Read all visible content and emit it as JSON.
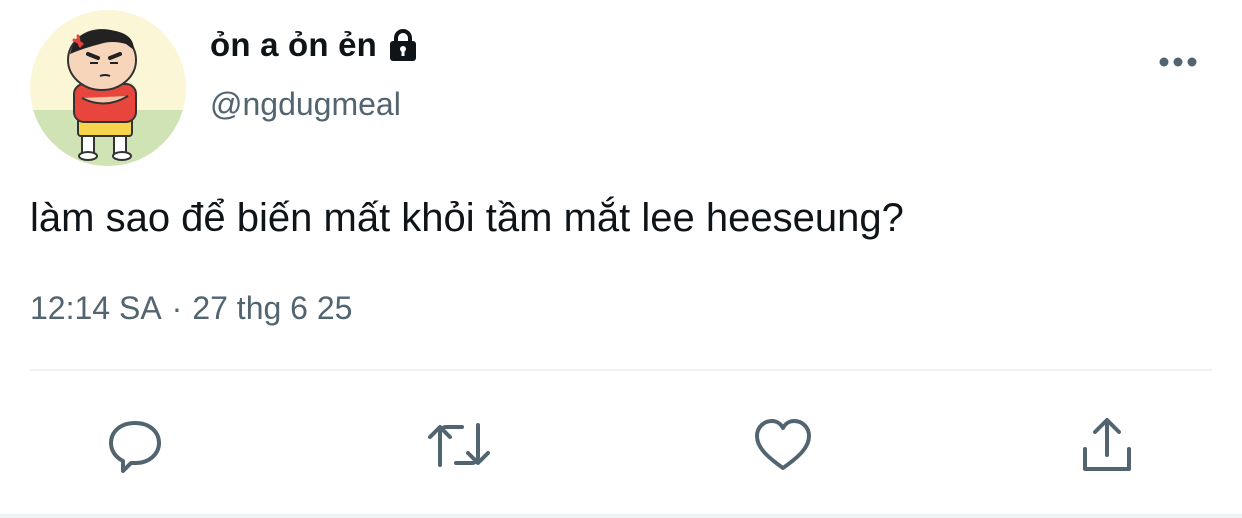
{
  "author": {
    "display_name": "ỏn a ỏn ẻn",
    "handle": "@ngdugmeal",
    "protected_icon": "lock-icon",
    "avatar": "cartoon-boy-avatar"
  },
  "tweet": {
    "text": "làm sao để biến mất khỏi tầm mắt lee heeseung?",
    "time": "12:14 SA",
    "separator": "·",
    "date": "27 thg 6 25"
  },
  "actions": [
    {
      "name": "reply",
      "icon": "reply-icon"
    },
    {
      "name": "retweet",
      "icon": "retweet-icon"
    },
    {
      "name": "like",
      "icon": "heart-icon"
    },
    {
      "name": "share",
      "icon": "share-icon"
    }
  ],
  "colors": {
    "text_primary": "#0f1419",
    "text_secondary": "#536471",
    "divider": "#eff3f4"
  }
}
